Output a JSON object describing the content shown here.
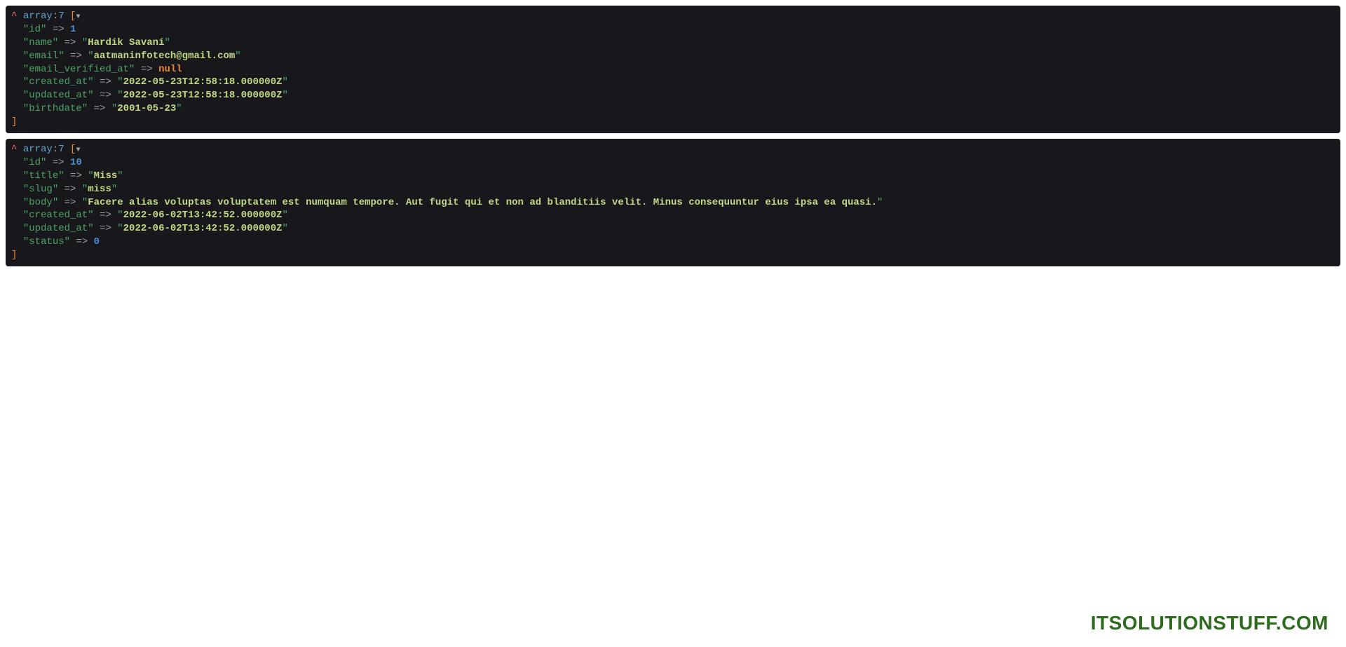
{
  "dumps": [
    {
      "header": {
        "caret": "^",
        "type": "array",
        "sep": ":",
        "count": "7",
        "open": " [",
        "icon": "▼"
      },
      "lines": [
        {
          "key": "id",
          "arrow": " => ",
          "value": "1",
          "kind": "num"
        },
        {
          "key": "name",
          "arrow": " => ",
          "value": "Hardik Savani",
          "kind": "str"
        },
        {
          "key": "email",
          "arrow": " => ",
          "value": "aatmaninfotech@gmail.com",
          "kind": "str"
        },
        {
          "key": "email_verified_at",
          "arrow": " => ",
          "value": "null",
          "kind": "null"
        },
        {
          "key": "created_at",
          "arrow": " => ",
          "value": "2022-05-23T12:58:18.000000Z",
          "kind": "str"
        },
        {
          "key": "updated_at",
          "arrow": " => ",
          "value": "2022-05-23T12:58:18.000000Z",
          "kind": "str"
        },
        {
          "key": "birthdate",
          "arrow": " => ",
          "value": "2001-05-23",
          "kind": "str"
        }
      ],
      "close": "]"
    },
    {
      "header": {
        "caret": "^",
        "type": "array",
        "sep": ":",
        "count": "7",
        "open": " [",
        "icon": "▼"
      },
      "lines": [
        {
          "key": "id",
          "arrow": " => ",
          "value": "10",
          "kind": "num"
        },
        {
          "key": "title",
          "arrow": " => ",
          "value": "Miss",
          "kind": "str"
        },
        {
          "key": "slug",
          "arrow": " => ",
          "value": "miss",
          "kind": "str"
        },
        {
          "key": "body",
          "arrow": " => ",
          "value": "Facere alias voluptas voluptatem est numquam tempore. Aut fugit qui et non ad blanditiis velit. Minus consequuntur eius ipsa ea quasi.",
          "kind": "str"
        },
        {
          "key": "created_at",
          "arrow": " => ",
          "value": "2022-06-02T13:42:52.000000Z",
          "kind": "str"
        },
        {
          "key": "updated_at",
          "arrow": " => ",
          "value": "2022-06-02T13:42:52.000000Z",
          "kind": "str"
        },
        {
          "key": "status",
          "arrow": " => ",
          "value": "0",
          "kind": "num"
        }
      ],
      "close": "]"
    }
  ],
  "watermark": "ITSOLUTIONSTUFF.COM"
}
